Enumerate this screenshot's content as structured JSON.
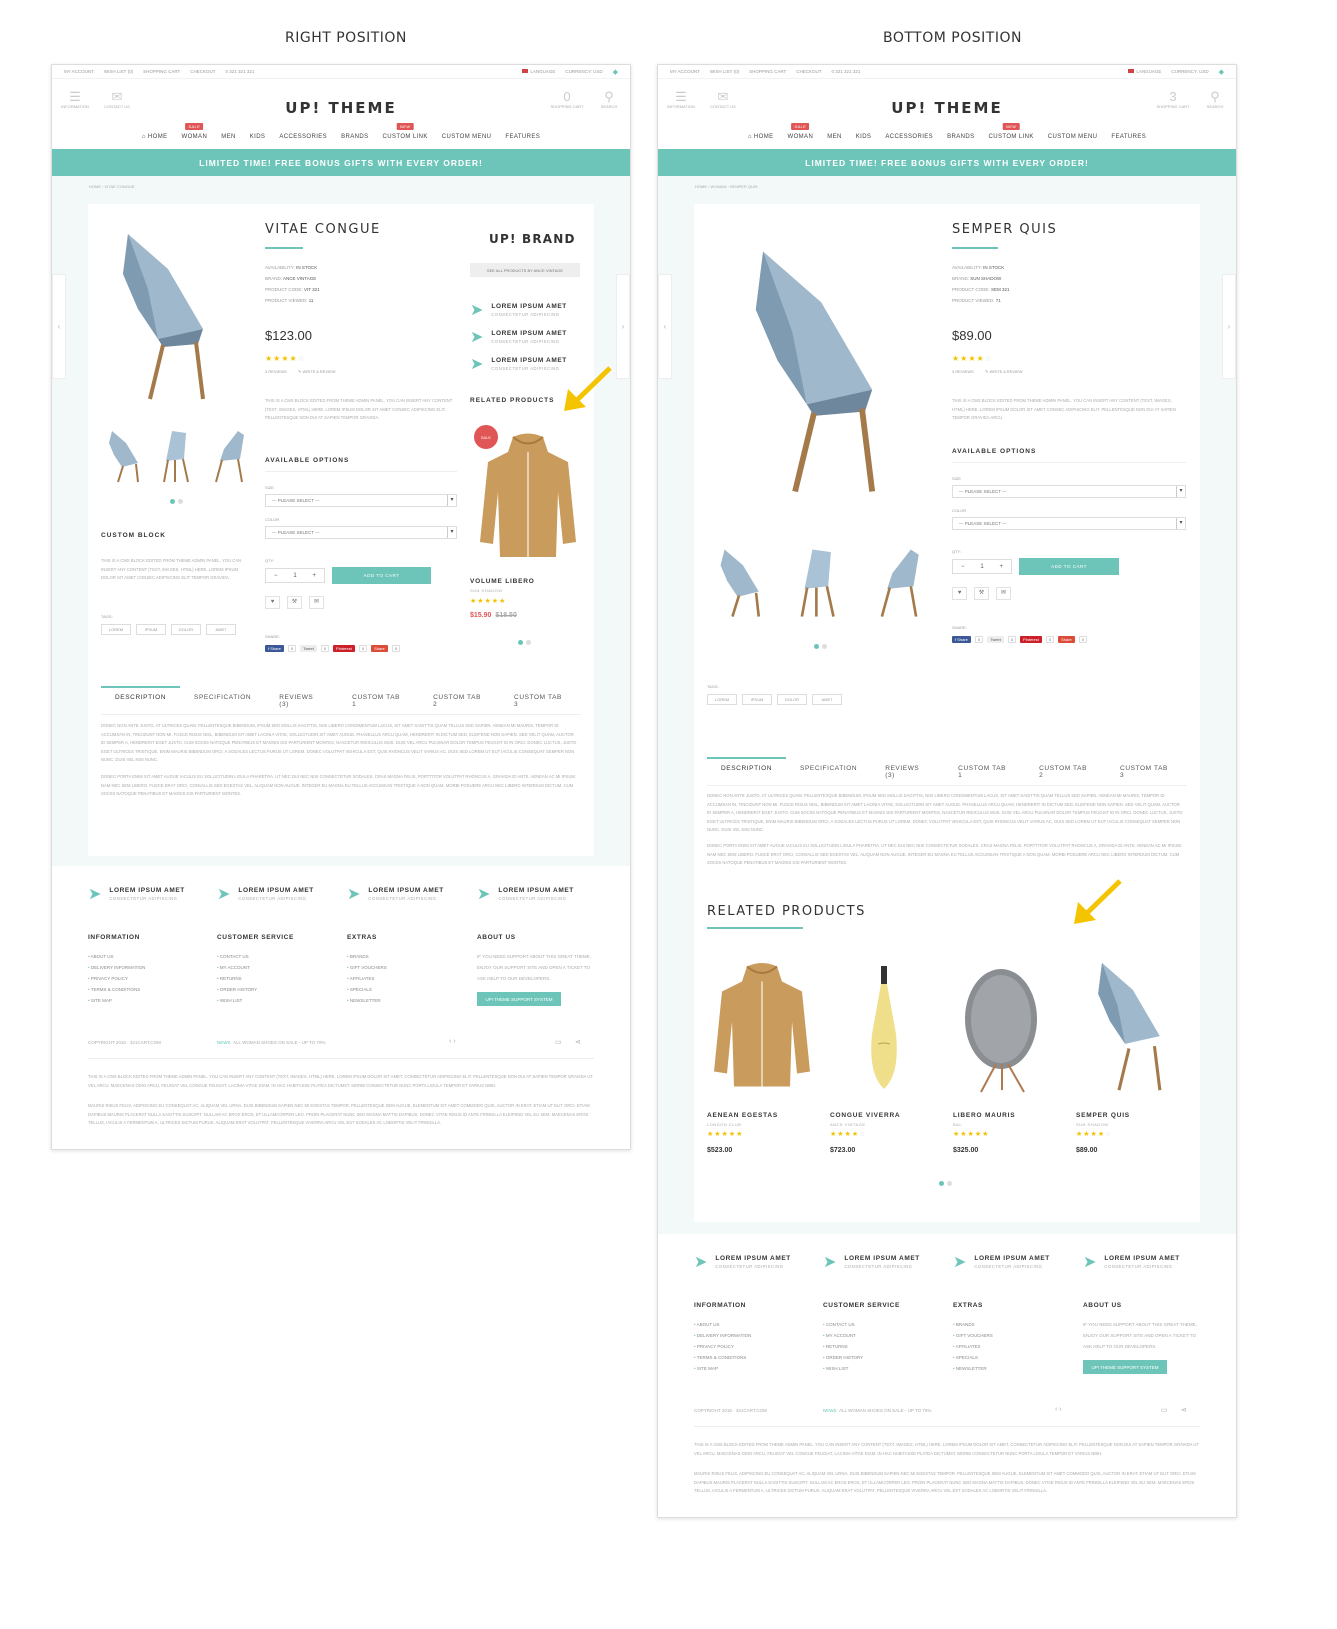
{
  "captions": {
    "left": "RIGHT POSITION",
    "right": "BOTTOM POSITION"
  },
  "topbar": {
    "account": "MY ACCOUNT",
    "wishlist": "WISH LIST (0)",
    "cart": "SHOPPING CART",
    "checkout": "CHECKOUT",
    "phone": "0 321 321 321",
    "language": "LANGUAGE",
    "currency": "CURRENCY: USD"
  },
  "header": {
    "logo": "UP! THEME",
    "info": "INFORMATION",
    "contact": "CONTACT US",
    "cart_count_left": "0",
    "cart_count_right": "3",
    "cart_label": "SHOPPING CART",
    "search": "SEARCH"
  },
  "nav": {
    "home": "HOME",
    "woman": "WOMAN",
    "men": "MEN",
    "kids": "KIDS",
    "accessories": "ACCESSORIES",
    "brands": "BRANDS",
    "custom_link": "CUSTOM LINK",
    "custom_menu": "CUSTOM MENU",
    "features": "FEATURES",
    "sale": "SALE",
    "new": "NEW"
  },
  "banner": "LIMITED TIME! FREE BONUS GIFTS WITH EVERY ORDER!",
  "left": {
    "crumb": "HOME  ›  VITAE CONGUE",
    "title": "VITAE CONGUE",
    "avail": "AVAILABILITY:",
    "avail_v": "IN STOCK",
    "brand": "BRAND:",
    "brand_v": "ANCE VINTAGE",
    "code": "PRODUCT CODE:",
    "code_v": "VIT 321",
    "viewed": "PRODUCT VIEWED:",
    "viewed_v": "11",
    "price": "$123.00",
    "reviews": "3 REVIEWS",
    "write": "✎ WRITE A REVIEW",
    "desc": "THIS IS A CMS BLOCK EDITED FROM THEME ADMIN PANEL. YOU CAN INSERT ANY CONTENT (TEXT, IMAGES, HTML) HERE. LOREM IPSUM DOLOR SIT AMET CONSEC ADIPISCING ELIT. PELLENTESQUE NON DUI AT SAPIEN TEMPOR GRAVIDA.",
    "custom_block": "CUSTOM BLOCK",
    "custom_text": "THIS IS A CMS BLOCK EDITED FROM THEME ADMIN PANEL. YOU CAN INSERT ANY CONTENT (TEXT, IMAGES, HTML) HERE. LOREM IPSUM DOLOR SIT AMET CONSEC ADIPISCING ELIT TEMPOR GRAVIDA.",
    "tags_label": "TAGS:",
    "tags": [
      "LOREM",
      "IPSUM",
      "DOLOR",
      "AMET"
    ],
    "brand_title": "UP! BRAND",
    "see_all": "SEE ALL PRODUCTS BY ANCE VINTAGE",
    "features": [
      {
        "t": "LOREM IPSUM AMET",
        "s": "CONSECTETUR ADIPISCING"
      },
      {
        "t": "LOREM IPSUM AMET",
        "s": "CONSECTETUR ADIPISCING"
      },
      {
        "t": "LOREM IPSUM AMET",
        "s": "CONSECTETUR ADIPISCING"
      }
    ],
    "related_label": "RELATED PRODUCTS",
    "sale": "SALE",
    "rel_name": "VOLUME LIBERO",
    "rel_brand": "SUN SHADOW",
    "rel_price": "$15.90",
    "rel_old": "$18.50"
  },
  "right": {
    "crumb": "HOME  ›  WOMAN  ›  SEMPER QUIS",
    "title": "SEMPER QUIS",
    "avail": "AVAILABILITY:",
    "avail_v": "IN STOCK",
    "brand": "BRAND:",
    "brand_v": "SUN SHADOW",
    "code": "PRODUCT CODE:",
    "code_v": "SEM 321",
    "viewed": "PRODUCT VIEWED:",
    "viewed_v": "71",
    "price": "$89.00",
    "reviews": "3 REVIEWS",
    "write": "✎ WRITE A REVIEW",
    "desc": "THIS IS A CMS BLOCK EDITED FROM THEME ADMIN PANEL. YOU CAN INSERT ANY CONTENT (TEXT, IMAGES, HTML) HERE. LOREM IPSUM DOLOR SIT AMET CONSEC ADIPISCING ELIT. PELLENTESQUE NON DUI AT SAPIEN TEMPOR GRAVIDA ARCU.",
    "tags_label": "TAGS:",
    "tags": [
      "LOREM",
      "IPSUM",
      "DOLOR",
      "AMET"
    ],
    "related_title": "RELATED PRODUCTS",
    "related": [
      {
        "name": "AENEAN EGESTAS",
        "brand": "LONDON CLUB",
        "price": "$523.00"
      },
      {
        "name": "CONGUE VIVERRA",
        "brand": "ANCE VINTAGE",
        "price": "$723.00"
      },
      {
        "name": "LIBERO MAURIS",
        "brand": "B&L",
        "price": "$325.00"
      },
      {
        "name": "SEMPER QUIS",
        "brand": "SUN SHADOW",
        "price": "$89.00"
      }
    ]
  },
  "common": {
    "options": "AVAILABLE OPTIONS",
    "size": "SIZE",
    "color": "COLOR",
    "please": "--- PLEASE SELECT ---",
    "qty": "QTY:",
    "qty_v": "1",
    "add": "ADD TO CART",
    "share": "SHARE:",
    "fb": "f Share",
    "tw": "Tweet",
    "pin": "Pinterest",
    "plus": "Share",
    "zero": "0",
    "tabs": [
      "DESCRIPTION",
      "SPECIFICATION",
      "REVIEWS (3)",
      "CUSTOM TAB 1",
      "CUSTOM TAB 2",
      "CUSTOM TAB 3"
    ],
    "tab_p1": "DONEC NON ANTE JUSTO, AT ULTRICES QUAM. PELLENTESQUE BIBENDUM, IPSUM SED MOLLIS SAGITTIS, NISI LIBERO CONDIMENTUM LACUS, SIT AMET SAGITTIS QUAM TELLUS SED SAPIEN. AENEAN MI MAURIS, TEMPOR ID ACCUMSAN IN, TINCIDUNT NON MI. FUSCE RISUS NISL, BIBENDUM SIT AMET LACINIA VITAE, SOLLICITUDIN SIT AMET AUGUE. PHASELLUS ARCU QUAM, HENDRERIT IN DICTUM SED, ELEIFEND NON SAPIEN. SED VELIT QUAM, AUCTOR ID SEMPER A, HENDRERIT EGET JUSTO. CUM SOCIIS NATOQUE PENATIBUS ET MAGNIS DIS PARTURIENT MONTES, NASCETUR RIDICULUS MUS. DUIS VEL ARCU PULVINAR DOLOR TEMPUS FEUGIAT ID IN ORCI. DONEC LUCTUS, JUSTO EGET ULTRICES TRISTIQUE, ENIM MAURIS BIBENDUM ORCI, A SODALES LECTUS PURUS UT LOREM. DONEC VOLUTPAT VEHICULA EST, QUIS RHONCUS VELIT VARIUS AC. DUIS SED LOREM UT EUT IACULIS CONSEQUAT SEMPER NON NUNC. DUIS VEL NISI NUNC.",
    "tab_p2": "DONEC PORTA ENIM SIT AMET AUGUE IACULIS EU SOLLICITUDIN LIGULA PHARETRA. UT NEC DUI NEC NISI CONSECTETUR SODALES. CRAS MAGNA FELIS, PORTTITOR VOLUTPAT RHONCUS A, GRAVIDA ID ANTE. AENEAN AC MI IPSUM. NAM NEC SEM LIBERO. FUSCE ERAT ORCI, CONVALLIS SED EGESTAS VEL, ALIQUAM NON AUGUE. INTEGER EU MAGNA EU TELLUS ACCUMSAN TRISTIQUE A NON QUAM. MORBI POSUERE ARCU NEC LIBERO INTERDUM DICTUM. CUM SOCIIS NATOQUE PENATIBUS ET MAGNIS DIS PARTURIENT MONTES."
  },
  "footer": {
    "features": [
      {
        "t": "LOREM IPSUM AMET",
        "s": "CONSECTETUR ADIPISCING"
      },
      {
        "t": "LOREM IPSUM AMET",
        "s": "CONSECTETUR ADIPISCING"
      },
      {
        "t": "LOREM IPSUM AMET",
        "s": "CONSECTETUR ADIPISCING"
      },
      {
        "t": "LOREM IPSUM AMET",
        "s": "CONSECTETUR ADIPISCING"
      }
    ],
    "information": {
      "h": "INFORMATION",
      "items": [
        "ABOUT US",
        "DELIVERY INFORMATION",
        "PRIVACY POLICY",
        "TERMS & CONDITIONS",
        "SITE MAP"
      ]
    },
    "service": {
      "h": "CUSTOMER SERVICE",
      "items": [
        "CONTACT US",
        "MY ACCOUNT",
        "RETURNS",
        "ORDER HISTORY",
        "WISH LIST"
      ]
    },
    "extras": {
      "h": "EXTRAS",
      "items": [
        "BRANDS",
        "GIFT VOUCHERS",
        "AFFILIATES",
        "SPECIALS",
        "NEWSLETTER"
      ]
    },
    "about": {
      "h": "ABOUT US",
      "text": "IF YOU NEED SUPPORT ABOUT THIS GREAT THEME, ENJOY OUR SUPPORT SITE AND OPEN A TICKET TO ASK HELP TO OUR DEVELOPERS.",
      "btn": "UP! THEME SUPPORT SYSTEM"
    },
    "copyright": "COPYRIGHT 2015 · 321CART.COM",
    "news": "NEWS",
    "news_text": "ALL WOMAN SHOES ON SALE - UP TO 70%",
    "cms1": "THIS IS A CMS BLOCK EDITED FROM THEME ADMIN PANEL. YOU CAN INSERT ANY CONTENT (TEXT, IMAGES, HTML) HERE. LOREM IPSUM DOLOR SIT AMET, CONSECTETUR ADIPISCING ELIT. PELLENTESQUE NON DUI AT SAPIEN TEMPOR GRAVIDA UT VEL ARCU. MAECENAS ODIO ARCU, FEUGIAT VEL CONGUE FEUGIAT, LACINIA VITAE DIAM. IN HAC HABITASSE PLATEA DICTUMST. MORBI CONSECTETUR NUNC PORTA LIGULA TEMPOR ET VARIUS NIBH.",
    "cms2": "MAURIS RISUS FELIS, ADIPISCING EU CONSEQUAT AC, ALIQUAM VEL URNA. DUIS BIBENDUM SAPIEN NEC MI EGESTAS TEMPOR. PELLENTESQUE SEM AUGUE, ELEMENTUM SIT AMET COMMODO QUIS, AUCTOR IN ERAT. ETIAM UT ELIT ORCI. ETIAM DAPIBUS MAURIS PLACERAT NULLA SAGITTIS SUSCIPIT. NULLAM AC EROS EROS, ET ULLAMCORPER LEO. PROIN PLACERAT NUNC SED MAGNA MATTIS DAPIBUS. DONEC VITAE RISUS ID ANTE FRINGILLA ELEIFEND VEL EU SEM. MAECENAS EROS TELLUS, IACULIS A FERMENTUM A, ULTRICES DICTUM PURUS. ALIQUAM ERAT VOLUTPAT. PELLENTESQUE VIVERRA ARCU VEL EST SODALES AC LOBORTIS VELIT FRINGILLA."
  },
  "colors": {
    "accent": "#6cc5b8",
    "sale": "#e05555",
    "star": "#f3c300",
    "arrow": "#f5c400"
  }
}
